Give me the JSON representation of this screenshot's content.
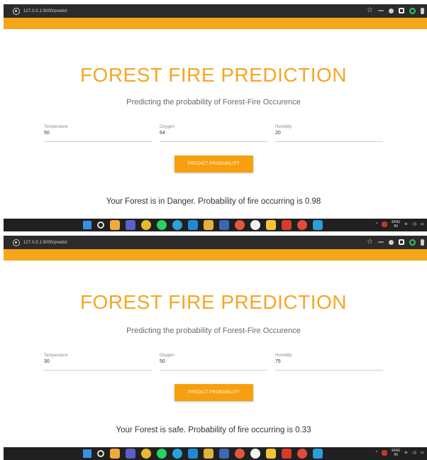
{
  "browser": {
    "url": "127.0.0.1:5000/predict",
    "star_glyph": "☆"
  },
  "colors": {
    "accent": "#f6a61b",
    "title": "#f6a623",
    "button": "#f7a00f",
    "taskbar": "#202020",
    "addressbar": "#2b2b2b"
  },
  "page": {
    "title": "FOREST FIRE PREDICTION",
    "subtitle": "Predicting the probability of Forest-Fire Occurence",
    "labels": {
      "temperature": "Temperature",
      "oxygen": "Oxygen",
      "humidity": "Humidity"
    },
    "button_label": "PREDICT PROBABILITY"
  },
  "screens": [
    {
      "temperature": "50",
      "oxygen": "64",
      "humidity": "20",
      "result": "Your Forest is in Danger. Probability of fire occurring is 0.98"
    },
    {
      "temperature": "30",
      "oxygen": "50",
      "humidity": "75",
      "result": "Your Forest is safe. Probability of fire occurring is 0.33"
    }
  ],
  "taskbar": {
    "icons": [
      "windows-start-icon",
      "search-icon",
      "app-icon",
      "teams-icon",
      "chrome-icon",
      "whatsapp-icon",
      "telegram-icon",
      "vscode-icon",
      "app-icon",
      "app-icon",
      "app-icon",
      "app-icon",
      "file-explorer-icon",
      "pdf-icon",
      "app-icon",
      "app-icon"
    ],
    "lang_top": "ENG",
    "lang_bottom": "IN"
  }
}
